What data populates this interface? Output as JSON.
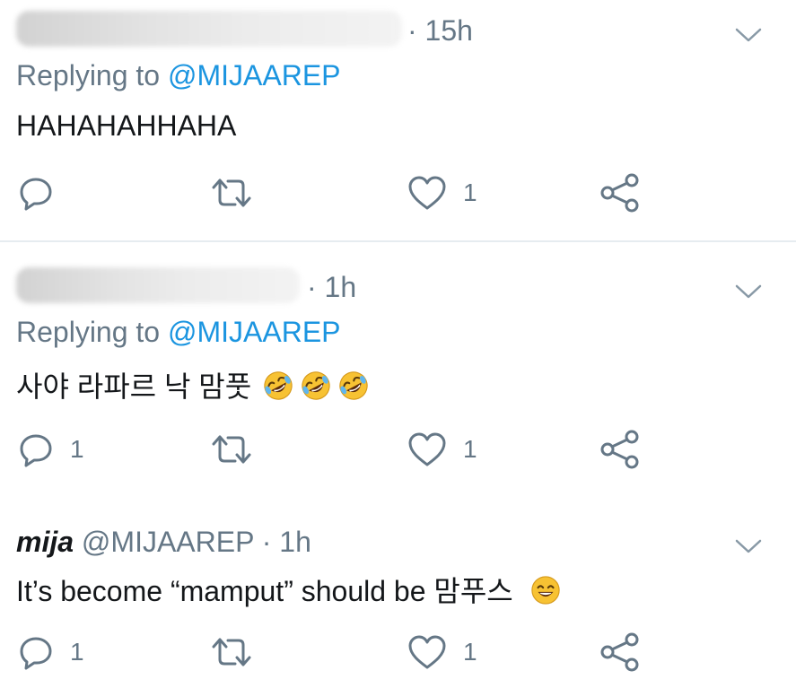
{
  "colors": {
    "secondary_text": "#657786",
    "primary_text": "#14171a",
    "link": "#1b95e0",
    "divider": "#e6ecf0",
    "icon": "#657786"
  },
  "tweets": [
    {
      "author_redacted": true,
      "time": "· 15h",
      "replying_prefix": "Replying to",
      "replying_handle": "@MIJAAREP",
      "text": "HAHAHAHHAHA",
      "emoji": [],
      "actions": {
        "reply_count": "",
        "retweet_count": "",
        "like_count": "1",
        "icons": [
          "reply-icon",
          "retweet-icon",
          "like-icon",
          "share-icon"
        ]
      }
    },
    {
      "author_redacted": true,
      "time": "· 1h",
      "replying_prefix": "Replying to",
      "replying_handle": "@MIJAAREP",
      "text": "사야 라파르 낙 맘풋",
      "emoji": [
        "rolling-on-floor-laughing-emoji",
        "rolling-on-floor-laughing-emoji",
        "rolling-on-floor-laughing-emoji"
      ],
      "actions": {
        "reply_count": "1",
        "retweet_count": "",
        "like_count": "1",
        "icons": [
          "reply-icon",
          "retweet-icon",
          "like-icon",
          "share-icon"
        ]
      }
    },
    {
      "author_redacted": false,
      "author_name": "mija",
      "author_handle": "@MIJAAREP",
      "time": "· 1h",
      "text": "It’s become “mamput” should be 맘푸스",
      "emoji": [
        "grinning-smiling-eyes-emoji"
      ],
      "actions": {
        "reply_count": "1",
        "retweet_count": "",
        "like_count": "1",
        "icons": [
          "reply-icon",
          "retweet-icon",
          "like-icon",
          "share-icon"
        ]
      }
    }
  ]
}
